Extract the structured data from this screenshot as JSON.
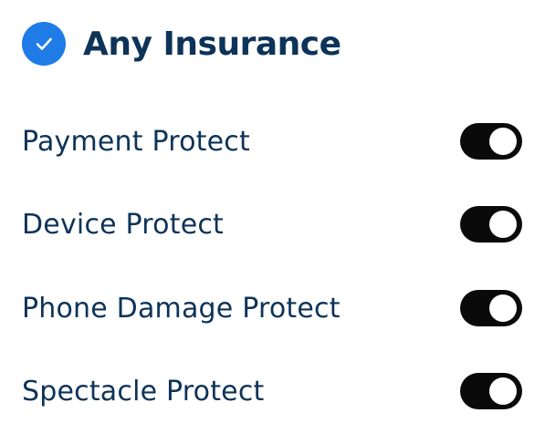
{
  "header": {
    "title": "Any Insurance",
    "icon": "check-circle-icon",
    "checked": true,
    "accent_color": "#1f7be6"
  },
  "options": [
    {
      "label": "Payment Protect",
      "enabled": true
    },
    {
      "label": "Device Protect",
      "enabled": true
    },
    {
      "label": "Phone Damage Protect",
      "enabled": true
    },
    {
      "label": "Spectacle Protect",
      "enabled": true
    }
  ],
  "colors": {
    "text": "#0d3358",
    "toggle_on": "#0a0a0a",
    "toggle_knob": "#ffffff"
  }
}
